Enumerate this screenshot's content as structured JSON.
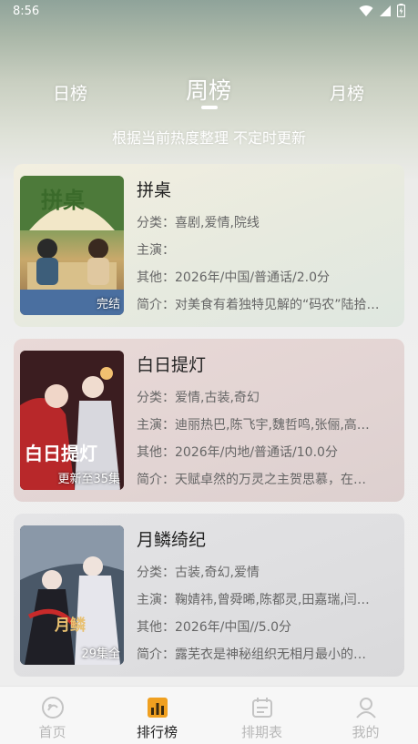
{
  "status_bar": {
    "time": "8:56"
  },
  "tabs": {
    "day": "日榜",
    "week": "周榜",
    "month": "月榜",
    "active": "周榜"
  },
  "subtitle": "根据当前热度整理 不定时更新",
  "items": [
    {
      "title": "拼桌",
      "category": "分类：喜剧,爱情,院线",
      "cast": "主演：",
      "other": "其他：2026年/中国/普通话/2.0分",
      "intro": "简介：对美食有着独特见解的“码农”陆拾…",
      "badge": "完结",
      "poster_text": "拼桌"
    },
    {
      "title": "白日提灯",
      "category": "分类：爱情,古装,奇幻",
      "cast": "主演：迪丽热巴,陈飞宇,魏哲鸣,张俪,高…",
      "other": "其他：2026年/内地/普通话/10.0分",
      "intro": "简介：天赋卓然的万灵之主贺思慕，在…",
      "badge": "更新至35集",
      "poster_text": "白日提灯"
    },
    {
      "title": "月鳞绮纪",
      "category": "分类：古装,奇幻,爱情",
      "cast": "主演：鞠婧祎,曾舜晞,陈都灵,田嘉瑞,闫…",
      "other": "其他：2026年/中国//5.0分",
      "intro": "简介：露芜衣是神秘组织无相月最小的…",
      "badge": "29集全",
      "poster_text": "月鳞"
    }
  ],
  "bottom_nav": [
    {
      "label": "首页",
      "icon": "home-icon"
    },
    {
      "label": "排行榜",
      "icon": "ranking-icon"
    },
    {
      "label": "排期表",
      "icon": "schedule-icon"
    },
    {
      "label": "我的",
      "icon": "profile-icon"
    }
  ],
  "colors": {
    "accent": "#f0a020",
    "nav_inactive": "#b8b8b8",
    "nav_active": "#222222"
  }
}
